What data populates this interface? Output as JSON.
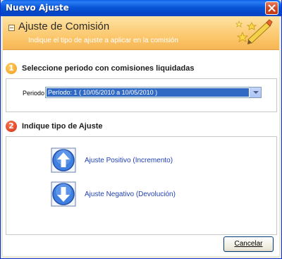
{
  "window": {
    "title": "Nuevo Ajuste"
  },
  "header": {
    "title": "Ajuste de Comisión",
    "subtitle": "Indique el tipo de ajuste a aplicar en la comisión"
  },
  "step1": {
    "number": "1",
    "label": "Seleccione periodo con comisiones liquidadas",
    "field_label": "Periodo",
    "selected_value": "Período: 1 ( 10/05/2010 a 10/05/2010 )"
  },
  "step2": {
    "number": "2",
    "label": "Indique tipo de Ajuste",
    "options": [
      {
        "label": "Ajuste Positivo (Incremento)",
        "icon": "arrow-up-icon"
      },
      {
        "label": "Ajuste Negativo (Devolución)",
        "icon": "arrow-down-icon"
      }
    ]
  },
  "footer": {
    "cancel_label": "Cancelar"
  },
  "colors": {
    "title_bar": "#0a56d8",
    "header_gradient": "#fcc86e",
    "link": "#1f3fb5",
    "selection": "#316ac5",
    "step1_badge": "#f29a10",
    "step2_badge": "#d62a10"
  }
}
